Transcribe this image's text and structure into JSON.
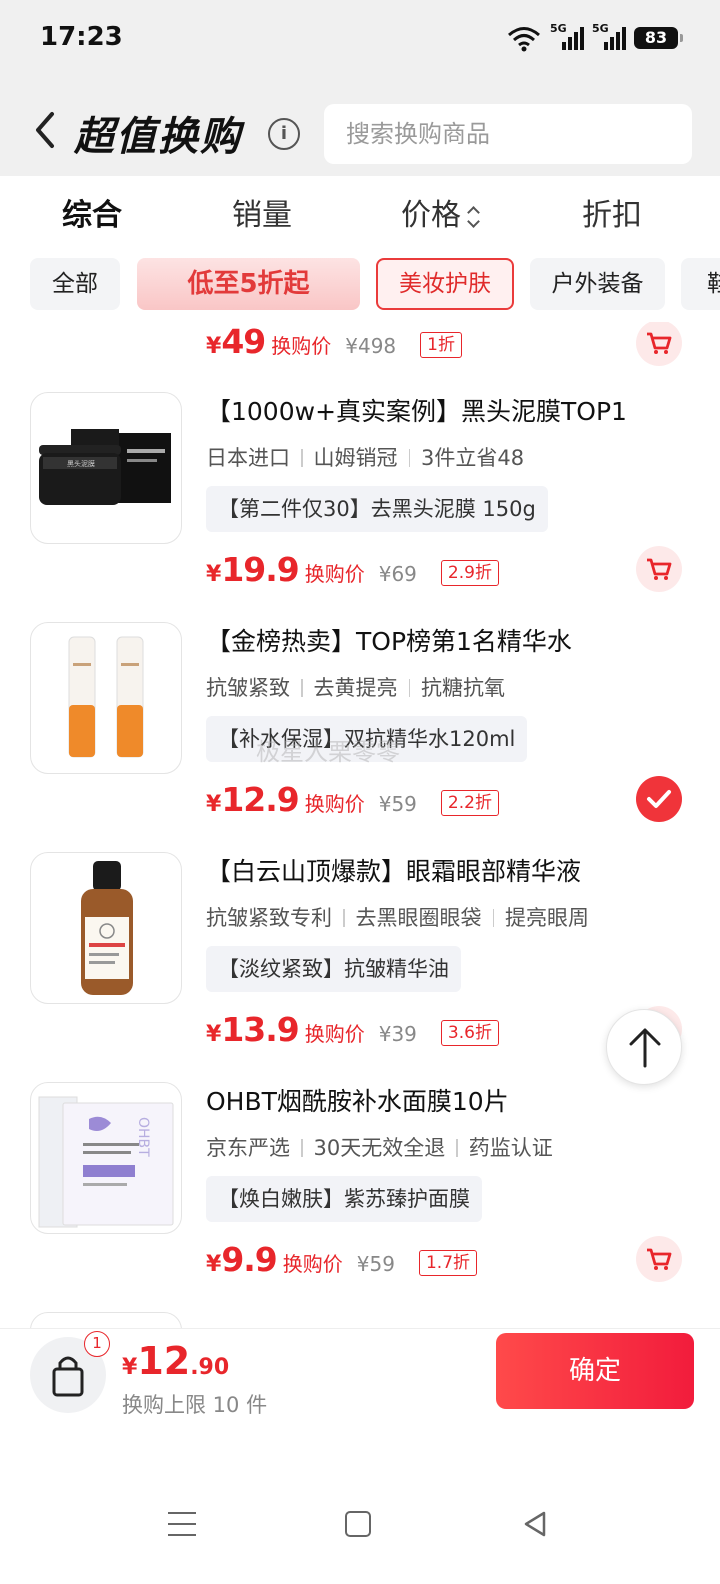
{
  "status_bar": {
    "time": "17:23",
    "signal1_tag": "5G",
    "signal2_tag": "5G",
    "battery": "83"
  },
  "header": {
    "title": "超值换购",
    "info_icon": "i",
    "search_placeholder": "搜索换购商品"
  },
  "sort_tabs": [
    {
      "label": "综合",
      "active": true
    },
    {
      "label": "销量",
      "active": false
    },
    {
      "label": "价格",
      "active": false
    },
    {
      "label": "折扣",
      "active": false
    }
  ],
  "categories": [
    {
      "label": "全部"
    },
    {
      "label": "低至5折起"
    },
    {
      "label": "美妆护肤",
      "selected": true
    },
    {
      "label": "户外装备"
    },
    {
      "label": "鞋"
    }
  ],
  "partial_item": {
    "currency": "¥",
    "price": "49",
    "price_label": "换购价",
    "original": "¥498",
    "discount": "1折"
  },
  "items": [
    {
      "title": "【1000w+真实案例】黑头泥膜TOP1",
      "tags": [
        "日本进口",
        "山姆销冠",
        "3件立省48"
      ],
      "subtitle": "【第二件仅30】去黑头泥膜 150g",
      "currency": "¥",
      "price": "19.9",
      "price_label": "换购价",
      "original": "¥69",
      "discount": "2.9折",
      "action": "cart"
    },
    {
      "title": "【金榜热卖】TOP榜第1名精华水",
      "tags": [
        "抗皱紧致",
        "去黄提亮",
        "抗糖抗氧"
      ],
      "subtitle": "【补水保湿】双抗精华水120ml",
      "currency": "¥",
      "price": "12.9",
      "price_label": "换购价",
      "original": "¥59",
      "discount": "2.2折",
      "action": "selected"
    },
    {
      "title": "【白云山顶爆款】眼霜眼部精华液",
      "tags": [
        "抗皱紧致专利",
        "去黑眼圈眼袋",
        "提亮眼周"
      ],
      "subtitle": "【淡纹紧致】抗皱精华油",
      "currency": "¥",
      "price": "13.9",
      "price_label": "换购价",
      "original": "¥39",
      "discount": "3.6折",
      "action": "cart"
    },
    {
      "title": "OHBT烟酰胺补水面膜10片",
      "tags": [
        "京东严选",
        "30天无效全退",
        "药监认证"
      ],
      "subtitle": "【焕白嫩肤】紫苏臻护面膜",
      "currency": "¥",
      "price": "9.9",
      "price_label": "换购价",
      "original": "¥59",
      "discount": "1.7折",
      "action": "cart"
    }
  ],
  "watermark": "极星人栗零零",
  "bottom_bar": {
    "bag_count": "1",
    "currency": "¥",
    "total_int": "12",
    "total_dec": ".90",
    "limit_text": "换购上限 10 件",
    "confirm_label": "确定"
  },
  "icons": {
    "back": "back-chevron-icon",
    "cart": "shopping-cart-icon",
    "check": "check-icon",
    "bag": "shopping-bag-icon",
    "scroll_top": "arrow-up-icon"
  },
  "colors": {
    "accent_red": "#e8262b",
    "header_bg": "#f0f0f0",
    "chip_bg": "#f3f4f6"
  }
}
